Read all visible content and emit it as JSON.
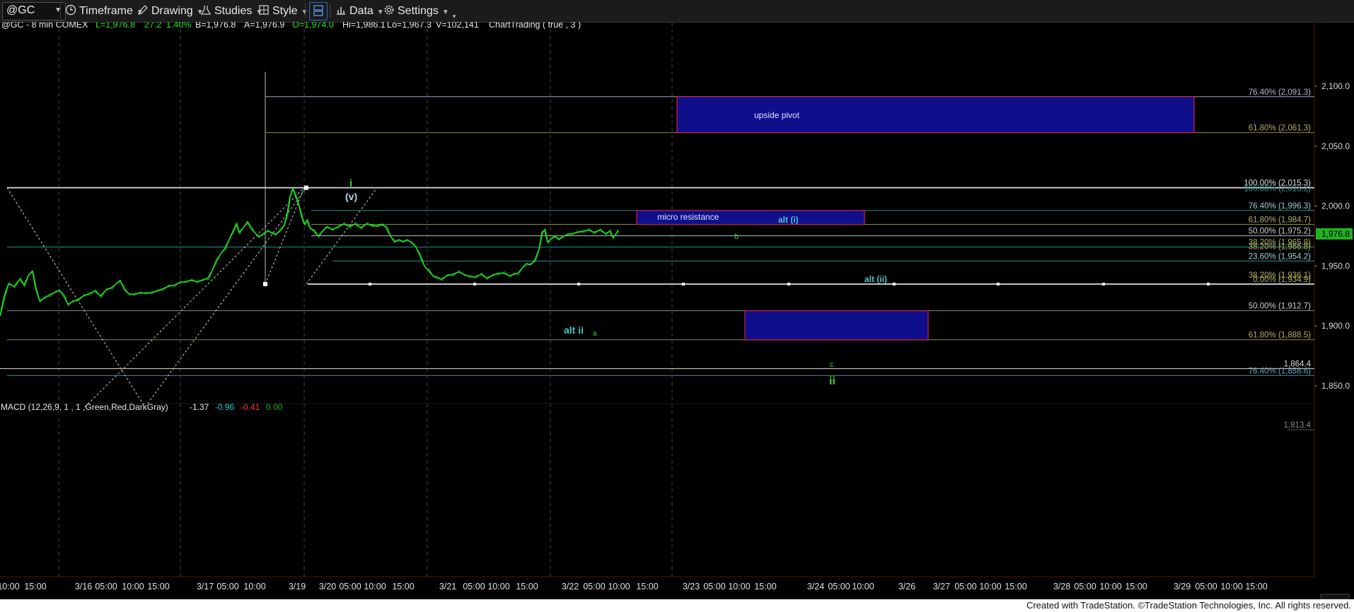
{
  "toolbar": {
    "symbol": "@GC",
    "items": [
      {
        "label": "Timeframe",
        "icon": "clock-icon"
      },
      {
        "label": "Drawing",
        "icon": "pencil-icon"
      },
      {
        "label": "Studies",
        "icon": "flask-icon"
      },
      {
        "label": "Style",
        "icon": "style-icon"
      },
      {
        "label": "",
        "icon": "layout-icon"
      },
      {
        "label": "Data",
        "icon": "bar-chart-icon"
      },
      {
        "label": "Settings",
        "icon": "gear-icon"
      }
    ]
  },
  "header": {
    "symbol_line": "@GC - 8 min  COMEX",
    "last": "L=1,976.8",
    "change": "27.2",
    "pct": "1.40%",
    "bid": "B=1,976.8",
    "ask": "A=1,976.9",
    "open": "O=1,974.0",
    "high": "Hi=1,986.1",
    "low": "Lo=1,967.3",
    "volume": "V=102,141",
    "chart_trading": "ChartTrading ( true , 3 )"
  },
  "macd": {
    "label": "MACD (12,26,9, 1 , 1 ,Green,Red,DarkGray)",
    "v1": "-1.37",
    "v2": "-0.96",
    "v3": "-0.41",
    "v4": "0.00"
  },
  "footer": {
    "text": "Created with TradeStation. ©TradeStation Technologies, Inc. All rights reserved."
  },
  "colors": {
    "price": "#22e022",
    "box_fill": "#0f0f8c",
    "box_border": "#cc2244",
    "fib_line": "#b0b0b0",
    "olive": "#8a8a3a",
    "teal": "#2f8f8f"
  },
  "chart_data": {
    "type": "line",
    "title": "@GC - 8 min",
    "ylim": [
      1813.4,
      2115
    ],
    "yticks": [
      1850,
      1900,
      1950,
      2000,
      2050,
      2100
    ],
    "ytick_labels": [
      "1,850.0",
      "1,900.0",
      "1,950.0",
      "2,000.0",
      "2,050.0",
      "2,100.0"
    ],
    "x_labels": [
      "10:00",
      "15:00",
      "3/16",
      "05:00",
      "10:00",
      "15:00",
      "3/17",
      "05:00",
      "10:00",
      "3/19",
      "3/20",
      "05:00",
      "10:00",
      "15:00",
      "3/21",
      "05:00",
      "10:00",
      "15:00",
      "3/22",
      "05:00",
      "10:00",
      "15:00",
      "3/23",
      "05:00",
      "10:00",
      "15:00",
      "3/24",
      "05:00",
      "10:00",
      "3/26",
      "3/27",
      "05:00",
      "10:00",
      "15:00",
      "3/28",
      "05:00",
      "10:00",
      "15:00",
      "3/29",
      "05:00",
      "10:00",
      "15:00"
    ],
    "last_price": "1,976.8",
    "series": [
      {
        "name": "@GC",
        "points": [
          [
            0,
            1908
          ],
          [
            6,
            1925
          ],
          [
            12,
            1935
          ],
          [
            20,
            1933
          ],
          [
            28,
            1939
          ],
          [
            34,
            1934
          ],
          [
            40,
            1942
          ],
          [
            46,
            1946
          ],
          [
            50,
            1932
          ],
          [
            56,
            1921
          ],
          [
            62,
            1923
          ],
          [
            70,
            1926
          ],
          [
            78,
            1928
          ],
          [
            84,
            1930
          ],
          [
            90,
            1925
          ],
          [
            96,
            1918
          ],
          [
            102,
            1920
          ],
          [
            110,
            1922
          ],
          [
            118,
            1925
          ],
          [
            126,
            1927
          ],
          [
            134,
            1929
          ],
          [
            142,
            1925
          ],
          [
            150,
            1930
          ],
          [
            158,
            1932
          ],
          [
            164,
            1935
          ],
          [
            170,
            1938
          ],
          [
            176,
            1930
          ],
          [
            182,
            1927
          ],
          [
            190,
            1926
          ],
          [
            198,
            1928
          ],
          [
            206,
            1927
          ],
          [
            214,
            1928
          ],
          [
            222,
            1929
          ],
          [
            230,
            1931
          ],
          [
            238,
            1933
          ],
          [
            246,
            1934
          ],
          [
            254,
            1936
          ],
          [
            262,
            1937
          ],
          [
            270,
            1938
          ],
          [
            278,
            1937
          ],
          [
            286,
            1938
          ],
          [
            294,
            1940
          ],
          [
            300,
            1946
          ],
          [
            306,
            1955
          ],
          [
            312,
            1960
          ],
          [
            318,
            1965
          ],
          [
            324,
            1972
          ],
          [
            330,
            1980
          ],
          [
            334,
            1985
          ],
          [
            338,
            1978
          ],
          [
            344,
            1982
          ],
          [
            350,
            1987
          ],
          [
            354,
            1982
          ],
          [
            360,
            1978
          ],
          [
            366,
            1974
          ],
          [
            372,
            1977
          ],
          [
            378,
            1979
          ],
          [
            384,
            1978
          ],
          [
            390,
            1976
          ],
          [
            396,
            1980
          ],
          [
            402,
            1984
          ],
          [
            406,
            1994
          ],
          [
            410,
            2008
          ],
          [
            414,
            2015
          ],
          [
            418,
            2008
          ],
          [
            422,
            2002
          ],
          [
            426,
            1992
          ],
          [
            430,
            1985
          ],
          [
            434,
            1988
          ],
          [
            438,
            1982
          ],
          [
            444,
            1979
          ],
          [
            450,
            1975
          ],
          [
            456,
            1979
          ],
          [
            462,
            1983
          ],
          [
            470,
            1980
          ],
          [
            478,
            1983
          ],
          [
            486,
            1985
          ],
          [
            494,
            1983
          ],
          [
            502,
            1985
          ],
          [
            510,
            1982
          ],
          [
            518,
            1985
          ],
          [
            526,
            1984
          ],
          [
            534,
            1983
          ],
          [
            540,
            1985
          ],
          [
            546,
            1982
          ],
          [
            552,
            1975
          ],
          [
            558,
            1970
          ],
          [
            564,
            1972
          ],
          [
            570,
            1970
          ],
          [
            576,
            1972
          ],
          [
            582,
            1969
          ],
          [
            588,
            1966
          ],
          [
            594,
            1958
          ],
          [
            600,
            1950
          ],
          [
            606,
            1946
          ],
          [
            612,
            1942
          ],
          [
            618,
            1940
          ],
          [
            624,
            1939
          ],
          [
            632,
            1942
          ],
          [
            640,
            1943
          ],
          [
            648,
            1945
          ],
          [
            656,
            1943
          ],
          [
            664,
            1941
          ],
          [
            672,
            1941
          ],
          [
            680,
            1943
          ],
          [
            688,
            1940
          ],
          [
            696,
            1942
          ],
          [
            704,
            1944
          ],
          [
            712,
            1944
          ],
          [
            720,
            1942
          ],
          [
            726,
            1943
          ],
          [
            732,
            1944
          ],
          [
            738,
            1948
          ],
          [
            744,
            1952
          ],
          [
            750,
            1951
          ],
          [
            756,
            1955
          ],
          [
            762,
            1964
          ],
          [
            766,
            1978
          ],
          [
            770,
            1980
          ],
          [
            774,
            1970
          ],
          [
            778,
            1972
          ],
          [
            784,
            1975
          ],
          [
            790,
            1972
          ],
          [
            796,
            1975
          ],
          [
            802,
            1976
          ],
          [
            808,
            1977
          ],
          [
            816,
            1978
          ],
          [
            824,
            1979
          ],
          [
            832,
            1980
          ],
          [
            840,
            1978
          ],
          [
            848,
            1980
          ],
          [
            856,
            1977
          ],
          [
            862,
            1979
          ],
          [
            866,
            1974
          ],
          [
            870,
            1976
          ],
          [
            874,
            1980
          ]
        ]
      }
    ],
    "horizontal_levels": [
      {
        "label": "76.40% (2,091.3)",
        "value": 2091.3
      },
      {
        "label": "61.80% (2,061.3)",
        "value": 2061.3
      },
      {
        "label": "100.00% (2,015.3)",
        "value": 2015.3
      },
      {
        "label": "76.40% (1,996.3)",
        "value": 1996.3
      },
      {
        "label": "61.80% (1,984.7)",
        "value": 1984.7
      },
      {
        "label": "50.00% (1,975.2)",
        "value": 1975.2
      },
      {
        "label": "38.20% (1,965.8)",
        "value": 1965.8
      },
      {
        "label": "23.60% (1,954.2)",
        "value": 1954.2
      },
      {
        "label": "0.00% (1,934.9)",
        "value": 1934.9
      },
      {
        "label": "50.00% (1,912.7)",
        "value": 1912.7
      },
      {
        "label": "61.80% (1,888.5)",
        "value": 1888.5
      },
      {
        "label": "1,864.4",
        "value": 1864.4
      },
      {
        "label": "76.40% (1,858.6)",
        "value": 1858.6
      },
      {
        "label": "1,813.4",
        "value": 1813.4
      }
    ],
    "boxes": [
      {
        "label": "upside pivot",
        "top": 2091.3,
        "bottom": 2061.3
      },
      {
        "label": "micro resistance",
        "top": 1996.3,
        "bottom": 1984.7
      },
      {
        "label": "",
        "top": 1912.7,
        "bottom": 1888.5
      }
    ],
    "wave_labels": [
      "i",
      "(v)",
      "alt (i)",
      "b",
      "alt (ii)",
      "alt ii",
      "a",
      "c",
      "ii"
    ]
  }
}
